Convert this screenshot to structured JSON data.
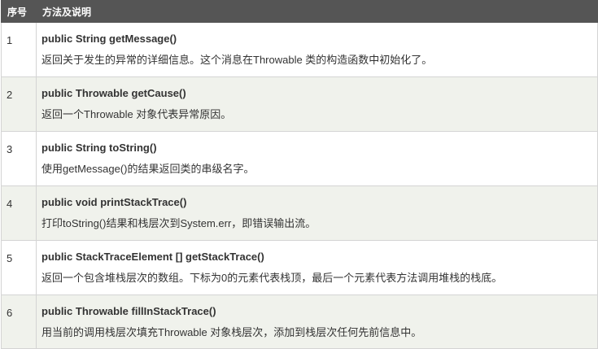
{
  "header": {
    "col_num": "序号",
    "col_desc": "方法及说明"
  },
  "rows": [
    {
      "num": "1",
      "method": "public String getMessage()",
      "desc": "返回关于发生的异常的详细信息。这个消息在Throwable 类的构造函数中初始化了。"
    },
    {
      "num": "2",
      "method": "public Throwable getCause()",
      "desc": "返回一个Throwable 对象代表异常原因。"
    },
    {
      "num": "3",
      "method": "public String toString()",
      "desc": "使用getMessage()的结果返回类的串级名字。"
    },
    {
      "num": "4",
      "method": "public void printStackTrace()",
      "desc": "打印toString()结果和栈层次到System.err，即错误输出流。"
    },
    {
      "num": "5",
      "method": "public StackTraceElement [] getStackTrace()",
      "desc": "返回一个包含堆栈层次的数组。下标为0的元素代表栈顶，最后一个元素代表方法调用堆栈的栈底。"
    },
    {
      "num": "6",
      "method": "public Throwable fillInStackTrace()",
      "desc": "用当前的调用栈层次填充Throwable 对象栈层次，添加到栈层次任何先前信息中。"
    }
  ],
  "colors": {
    "header_bg": "#555555",
    "header_text": "#ffffff",
    "row_alt_bg": "#f0f2ec",
    "border": "#d4d4d4"
  }
}
